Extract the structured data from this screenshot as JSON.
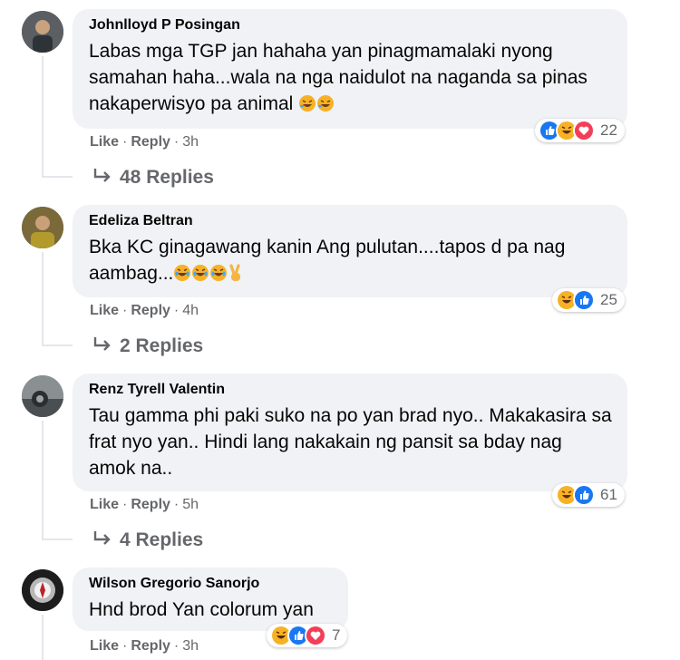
{
  "colors": {
    "bubble_bg": "#f0f2f5",
    "secondary_text": "#65676b",
    "like_blue": "#1877f2",
    "haha_yellow": "#f7b125",
    "love_red": "#f33e58"
  },
  "comments": [
    {
      "author": "Johnlloyd P Posingan",
      "text": "Labas mga TGP jan hahaha yan pinagmamalaki nyong samahan haha...wala na nga naidulot na naganda sa pinas nakaperwisyo pa animal",
      "emojis": [
        "rolling-laughing-emoji",
        "rolling-laughing-emoji"
      ],
      "like_label": "Like",
      "reply_label": "Reply",
      "time": "3h",
      "reactions": [
        "like",
        "haha",
        "love"
      ],
      "reaction_count": "22",
      "replies_label": "48 Replies"
    },
    {
      "author": "Edeliza Beltran",
      "text": "Bka KC ginagawang kanin Ang pulutan....tapos d pa nag aambag...",
      "emojis": [
        "laughing-emoji",
        "laughing-emoji",
        "laughing-emoji",
        "victory-hand-emoji"
      ],
      "like_label": "Like",
      "reply_label": "Reply",
      "time": "4h",
      "reactions": [
        "haha",
        "like"
      ],
      "reaction_count": "25",
      "replies_label": "2 Replies"
    },
    {
      "author": "Renz Tyrell Valentin",
      "text": "Tau gamma phi paki suko na po yan brad nyo.. Makakasira sa frat nyo yan.. Hindi lang nakakain ng pansit sa bday nag amok na..",
      "like_label": "Like",
      "reply_label": "Reply",
      "time": "5h",
      "reactions": [
        "haha",
        "like"
      ],
      "reaction_count": "61",
      "replies_label": "4 Replies"
    },
    {
      "author": "Wilson Gregorio Sanorjo",
      "text": "Hnd brod Yan colorum yan",
      "like_label": "Like",
      "reply_label": "Reply",
      "time": "3h",
      "reactions": [
        "haha",
        "like",
        "love"
      ],
      "reaction_count": "7"
    }
  ]
}
